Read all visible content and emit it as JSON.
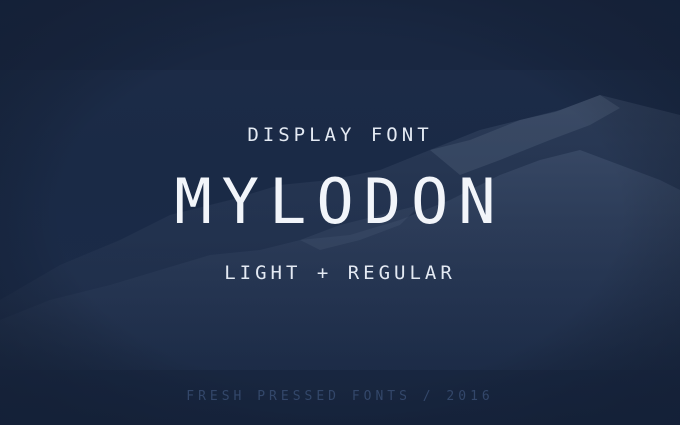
{
  "poster": {
    "subtitle": "DISPLAY FONT",
    "title": "MYLODON",
    "weights": "LIGHT + REGULAR",
    "credit": "FRESH PRESSED FONTS / 2016"
  },
  "colors": {
    "background": "#1b2a45",
    "text": "#f2f5fa",
    "credit": "#33476a"
  }
}
